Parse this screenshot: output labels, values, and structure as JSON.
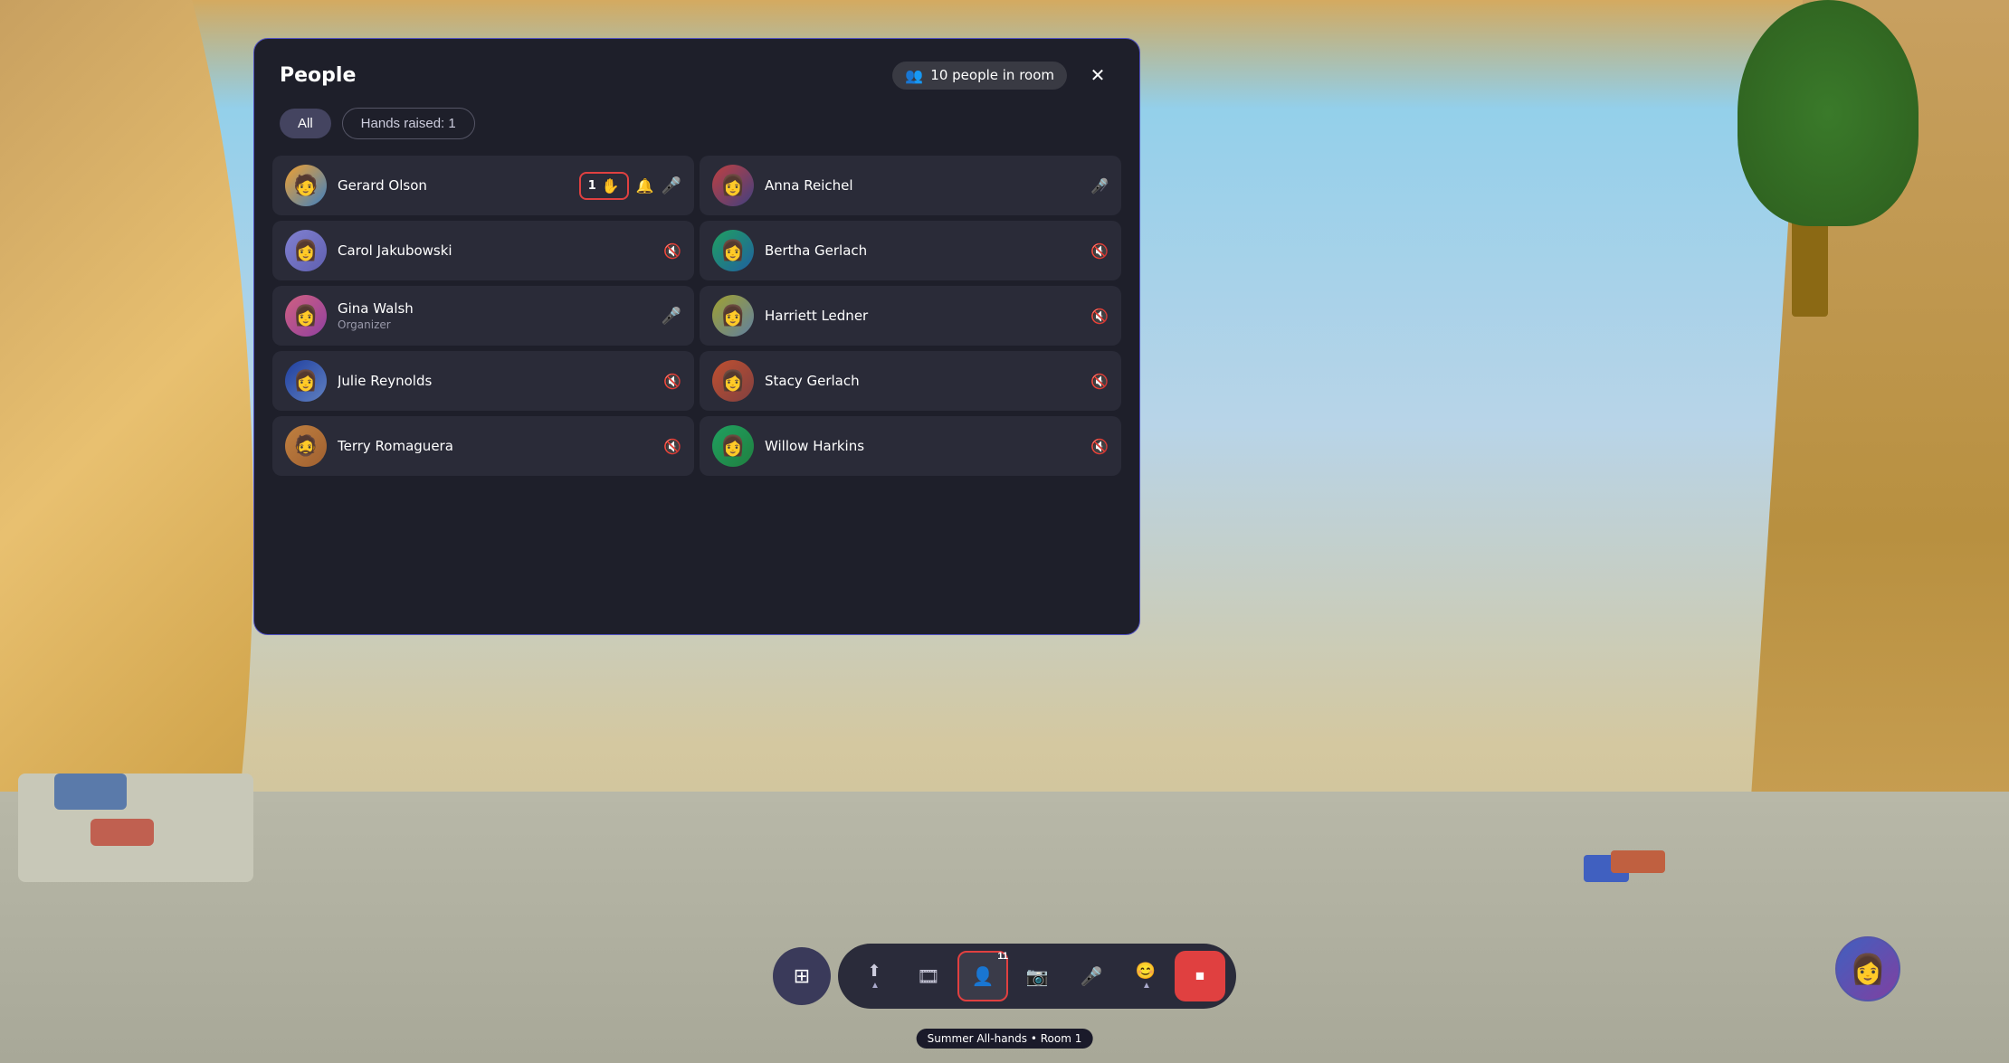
{
  "background": {
    "colors": {
      "sky": "#87CEEB",
      "floor": "#b8b8a8",
      "wood": "#c8a060"
    }
  },
  "panel": {
    "title": "People",
    "people_count_label": "10 people in room",
    "close_label": "✕",
    "filters": {
      "all_label": "All",
      "hands_raised_label": "Hands raised: 1"
    },
    "people": [
      {
        "id": "gerard",
        "name": "Gerard Olson",
        "role": "",
        "avatar_class": "avatar-gerard",
        "has_hand": true,
        "hand_count": "1",
        "mic": "active",
        "avatar_emoji": "🧑"
      },
      {
        "id": "anna",
        "name": "Anna Reichel",
        "role": "",
        "avatar_class": "avatar-anna",
        "has_hand": false,
        "mic": "muted",
        "avatar_emoji": "👩"
      },
      {
        "id": "carol",
        "name": "Carol Jakubowski",
        "role": "",
        "avatar_class": "avatar-carol",
        "has_hand": false,
        "mic": "muted",
        "avatar_emoji": "👩"
      },
      {
        "id": "bertha",
        "name": "Bertha Gerlach",
        "role": "",
        "avatar_class": "avatar-bertha",
        "has_hand": false,
        "mic": "muted",
        "avatar_emoji": "👩"
      },
      {
        "id": "gina",
        "name": "Gina Walsh",
        "role": "Organizer",
        "avatar_class": "avatar-gina",
        "has_hand": false,
        "mic": "active",
        "avatar_emoji": "👩"
      },
      {
        "id": "harriett",
        "name": "Harriett Ledner",
        "role": "",
        "avatar_class": "avatar-harriett",
        "has_hand": false,
        "mic": "muted",
        "avatar_emoji": "👩"
      },
      {
        "id": "julie",
        "name": "Julie Reynolds",
        "role": "",
        "avatar_class": "avatar-julie",
        "has_hand": false,
        "mic": "muted",
        "avatar_emoji": "👩"
      },
      {
        "id": "stacy",
        "name": "Stacy Gerlach",
        "role": "",
        "avatar_class": "avatar-stacy",
        "has_hand": false,
        "mic": "muted",
        "avatar_emoji": "👩"
      },
      {
        "id": "terry",
        "name": "Terry Romaguera",
        "role": "",
        "avatar_class": "avatar-terry",
        "has_hand": false,
        "mic": "muted",
        "avatar_emoji": "🧔"
      },
      {
        "id": "willow",
        "name": "Willow Harkins",
        "role": "",
        "avatar_class": "avatar-willow",
        "has_hand": false,
        "mic": "muted",
        "avatar_emoji": "👩"
      }
    ]
  },
  "toolbar": {
    "grid_btn_label": "⊞",
    "present_label": "⬆",
    "slides_label": "▭",
    "people_label": "👤",
    "people_count": "11",
    "camera_label": "📷",
    "mic_label": "🎤",
    "emoji_label": "😊",
    "end_call_label": "⏹",
    "tooltip": "Summer All-hands • Room 1"
  }
}
